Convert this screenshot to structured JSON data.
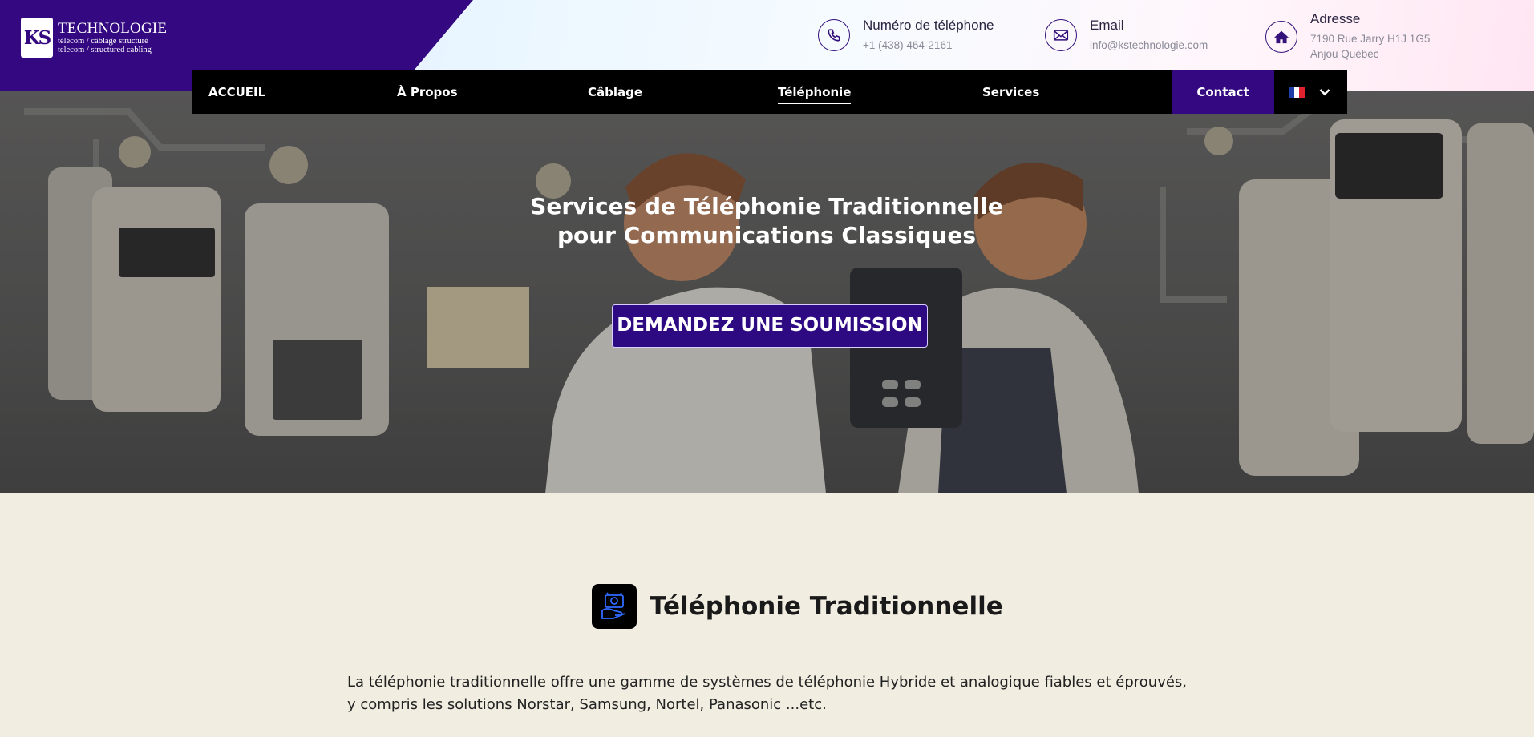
{
  "brand": {
    "logo_mark": "KS",
    "name": "TECHNOLOGIE",
    "tagline_fr": "télécom / câblage structuré",
    "tagline_en": "telecom / structured cabling"
  },
  "contacts": [
    {
      "icon": "phone-icon",
      "title": "Numéro de téléphone",
      "value": "+1 (438) 464-2161"
    },
    {
      "icon": "mail-icon",
      "title": "Email",
      "value": "info@kstechnologie.com"
    },
    {
      "icon": "home-icon",
      "title": "Adresse",
      "value_line1": "7190 Rue Jarry H1J 1G5",
      "value_line2": "Anjou Québec"
    }
  ],
  "nav": {
    "items": [
      "ACCUEIL",
      "À Propos",
      "Câblage",
      "Téléphonie",
      "Services"
    ],
    "active": "Téléphonie",
    "contact_label": "Contact",
    "language": "fr"
  },
  "hero": {
    "title": "Services de Téléphonie Traditionnelle pour Communications Classiques",
    "cta_label": "DEMANDEZ UNE SOUMISSION"
  },
  "section": {
    "icon": "telephone-system-icon",
    "title": "Téléphonie Traditionnelle",
    "body": "La téléphonie traditionnelle offre une gamme de systèmes de téléphonie Hybride et analogique fiables et éprouvés, y compris les solutions Norstar, Samsung, Nortel, Panasonic ...etc."
  },
  "colors": {
    "brand_purple": "#330880",
    "nav_bg": "#000000",
    "page_bg": "#f1ede1"
  }
}
